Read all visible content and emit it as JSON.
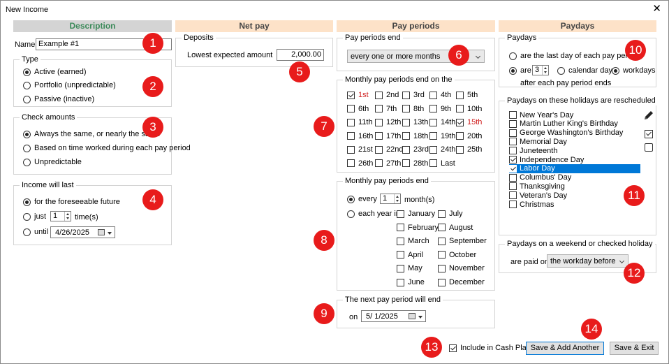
{
  "window": {
    "title": "New Income",
    "close_glyph": "✕"
  },
  "headers": {
    "description": "Description",
    "net_pay": "Net pay",
    "pay_periods": "Pay periods",
    "paydays": "Paydays"
  },
  "description": {
    "name_label": "Name",
    "name_value": "Example #1",
    "type": {
      "title": "Type",
      "options": [
        "Active (earned)",
        "Portfolio (unpredictable)",
        "Passive (inactive)"
      ],
      "selected": 0
    },
    "check_amounts": {
      "title": "Check amounts",
      "options": [
        "Always the same, or nearly the same",
        "Based on time worked during each pay period",
        "Unpredictable"
      ],
      "selected": 0
    },
    "income_will_last": {
      "title": "Income will last",
      "opt_foreseeable": "for the foreseeable future",
      "opt_just": "just",
      "just_value": "1",
      "times_label": "time(s)",
      "opt_until": "until",
      "until_date": "4/26/2025"
    }
  },
  "net_pay": {
    "deposits_title": "Deposits",
    "lowest_label": "Lowest expected amount",
    "lowest_value": "2,000.00"
  },
  "pay_periods": {
    "end_title": "Pay periods end",
    "end_value": "every one or more months",
    "monthly_title": "Monthly pay periods end on the",
    "days": [
      {
        "label": "1st",
        "checked": true,
        "red": true
      },
      {
        "label": "2nd",
        "checked": false,
        "red": false
      },
      {
        "label": "3rd",
        "checked": false,
        "red": false
      },
      {
        "label": "4th",
        "checked": false,
        "red": false
      },
      {
        "label": "5th",
        "checked": false,
        "red": false
      },
      {
        "label": "6th",
        "checked": false,
        "red": false
      },
      {
        "label": "7th",
        "checked": false,
        "red": false
      },
      {
        "label": "8th",
        "checked": false,
        "red": false
      },
      {
        "label": "9th",
        "checked": false,
        "red": false
      },
      {
        "label": "10th",
        "checked": false,
        "red": false
      },
      {
        "label": "11th",
        "checked": false,
        "red": false
      },
      {
        "label": "12th",
        "checked": false,
        "red": false
      },
      {
        "label": "13th",
        "checked": false,
        "red": false
      },
      {
        "label": "14th",
        "checked": false,
        "red": false
      },
      {
        "label": "15th",
        "checked": true,
        "red": true
      },
      {
        "label": "16th",
        "checked": false,
        "red": false
      },
      {
        "label": "17th",
        "checked": false,
        "red": false
      },
      {
        "label": "18th",
        "checked": false,
        "red": false
      },
      {
        "label": "19th",
        "checked": false,
        "red": false
      },
      {
        "label": "20th",
        "checked": false,
        "red": false
      },
      {
        "label": "21st",
        "checked": false,
        "red": false
      },
      {
        "label": "22nd",
        "checked": false,
        "red": false
      },
      {
        "label": "23rd",
        "checked": false,
        "red": false
      },
      {
        "label": "24th",
        "checked": false,
        "red": false
      },
      {
        "label": "25th",
        "checked": false,
        "red": false
      },
      {
        "label": "26th",
        "checked": false,
        "red": false
      },
      {
        "label": "27th",
        "checked": false,
        "red": false
      },
      {
        "label": "28th",
        "checked": false,
        "red": false
      },
      {
        "label": "Last",
        "checked": false,
        "red": false
      }
    ],
    "monthly_end_title": "Monthly pay periods end",
    "every_label": "every",
    "every_value": "1",
    "months_label": "month(s)",
    "each_year_label": "each year in",
    "months": [
      "January",
      "July",
      "February",
      "August",
      "March",
      "September",
      "April",
      "October",
      "May",
      "November",
      "June",
      "December"
    ],
    "next_title": "The next pay period will end",
    "on_label": "on",
    "next_date": "5/ 1/2025"
  },
  "paydays": {
    "title": "Paydays",
    "opt_last_day": "are the last day of each pay period",
    "opt_are": "are",
    "are_value": "3",
    "calendar_days": "calendar days",
    "workdays": "workdays",
    "after_text": "after each pay period ends",
    "holidays_title": "Paydays on these holidays are rescheduled",
    "holidays": [
      {
        "label": "New Year's Day",
        "checked": false
      },
      {
        "label": "Martin Luther King's Birthday",
        "checked": false
      },
      {
        "label": "George Washington's Birthday",
        "checked": false
      },
      {
        "label": "Memorial Day",
        "checked": false
      },
      {
        "label": "Juneteenth",
        "checked": false
      },
      {
        "label": "Independence Day",
        "checked": true
      },
      {
        "label": "Labor Day",
        "checked": true
      },
      {
        "label": "Columbus' Day",
        "checked": false
      },
      {
        "label": "Thanksgiving",
        "checked": false
      },
      {
        "label": "Veteran's Day",
        "checked": false
      },
      {
        "label": "Christmas",
        "checked": false
      }
    ],
    "weekend_title": "Paydays on a weekend or checked holiday",
    "paid_on_label": "are paid on",
    "paid_on_value": "the workday before"
  },
  "footer": {
    "include_label": "Include in Cash Plan",
    "save_add": "Save & Add Another",
    "save_exit": "Save & Exit"
  },
  "markers": [
    "1",
    "2",
    "3",
    "4",
    "5",
    "6",
    "7",
    "8",
    "9",
    "10",
    "11",
    "12",
    "13",
    "14"
  ],
  "colors": {
    "marker": "#e81b1b",
    "selection": "#0078d7",
    "header_orange": "#fde2c8",
    "header_gray": "#d4d4d4",
    "header_green_text": "#3c8a5a"
  }
}
